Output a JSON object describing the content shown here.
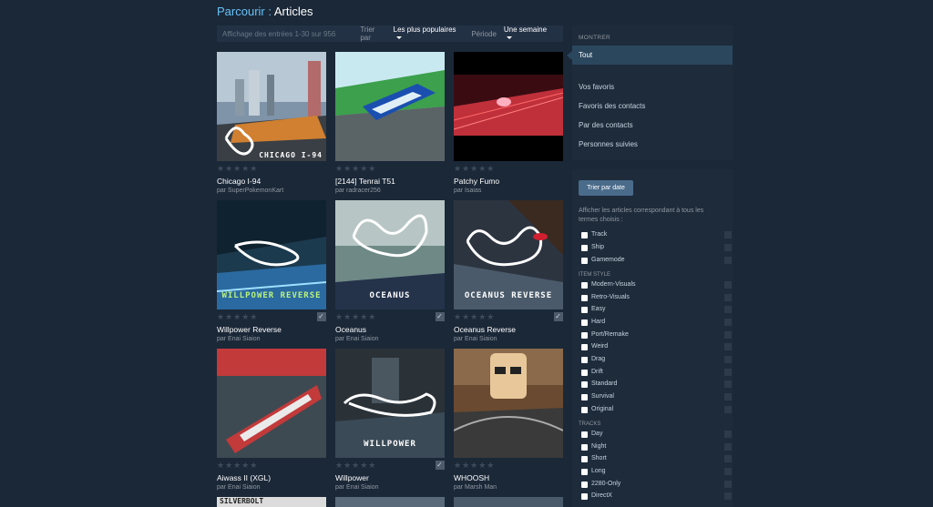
{
  "breadcrumb": {
    "link": "Parcourir",
    "separator": " : ",
    "current": "Articles"
  },
  "filter": {
    "count_text": "Affichage des entrées 1-30 sur 956",
    "sort_label": "Trier par",
    "sort_value": "Les plus populaires",
    "period_label": "Période",
    "period_value": "Une semaine"
  },
  "items": [
    {
      "title": "Chicago I-94",
      "author": "par SuperPokemonKart",
      "thumb_label": "CHICAGO I-94",
      "subscribed": false
    },
    {
      "title": "[2144] Tenrai T51",
      "author": "par radracer256",
      "thumb_label": "",
      "subscribed": false
    },
    {
      "title": "Patchy Fumo",
      "author": "par Isaias",
      "thumb_label": "",
      "subscribed": false
    },
    {
      "title": "Willpower Reverse",
      "author": "par Enai Siaion",
      "thumb_label": "WILLPOWER REVERSE",
      "subscribed": true
    },
    {
      "title": "Oceanus",
      "author": "par Enai Siaion",
      "thumb_label": "OCEANUS",
      "subscribed": true
    },
    {
      "title": "Oceanus Reverse",
      "author": "par Enai Siaion",
      "thumb_label": "OCEANUS REVERSE",
      "subscribed": true
    },
    {
      "title": "Aiwass II (XGL)",
      "author": "par Enai Siaion",
      "thumb_label": "",
      "subscribed": false
    },
    {
      "title": "Willpower",
      "author": "par Enai Siaion",
      "thumb_label": "WILLPOWER",
      "subscribed": true
    },
    {
      "title": "WHOOSH",
      "author": "par Marsh Man",
      "thumb_label": "",
      "subscribed": false
    }
  ],
  "partial_row_label": "SILVERBOLT",
  "show": {
    "heading": "MONTRER",
    "items": [
      "Tout",
      "Vos favoris",
      "Favoris des contacts",
      "Par des contacts",
      "Personnes suivies"
    ]
  },
  "filters_panel": {
    "sort_button": "Trier par date",
    "description": "Afficher les articles correspondant à tous les termes choisis :",
    "type_tags": [
      "Track",
      "Ship",
      "Gamemode"
    ],
    "item_style_heading": "ITEM STYLE",
    "item_style_tags": [
      "Modern-Visuals",
      "Retro-Visuals",
      "Easy",
      "Hard",
      "Port/Remake",
      "Weird",
      "Drag",
      "Drift",
      "Standard",
      "Survival",
      "Original"
    ],
    "tracks_heading": "TRACKS",
    "tracks_tags": [
      "Day",
      "Night",
      "Short",
      "Long",
      "2280-Only",
      "DirectX"
    ]
  },
  "colors": {
    "background": "#1b2838",
    "link": "#67c1f5",
    "panel": "#1e2b3b",
    "active": "#2a475e"
  }
}
